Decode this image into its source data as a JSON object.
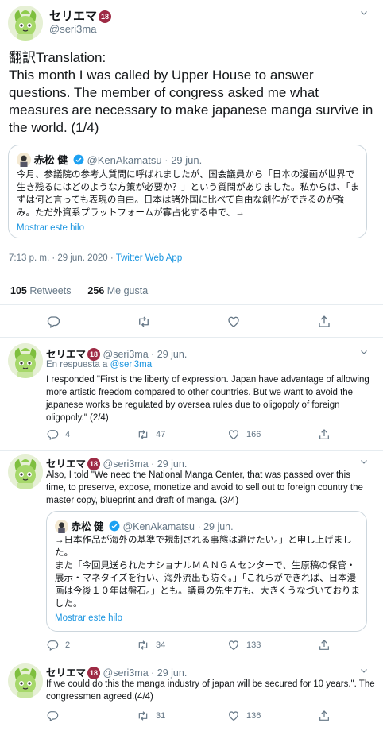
{
  "main": {
    "display_name": "セリエマ",
    "badge": "18",
    "handle": "@seri3ma",
    "text": "翻訳Translation:\nThis month I was called by Upper House to answer questions. The member of congress asked me what measures are necessary to make japanese manga survive in the world. (1/4)",
    "quote": {
      "display_name": "赤松 健",
      "handle": "@KenAkamatsu",
      "date": "· 29 jun.",
      "text": "今月、参議院の参考人質問に呼ばれましたが、国会議員から「日本の漫画が世界で生き残るにはどのような方策が必要か？」という質問がありました。私からは、「まずは何と言っても表現の自由。日本は諸外国に比べて自由な創作ができるのが強み。ただ外資系プラットフォームが寡占化する中で、→",
      "show_thread": "Mostrar este hilo"
    },
    "timestamp": "7:13 p. m. · 29 jun. 2020",
    "source": "Twitter Web App",
    "retweets_count": "105",
    "retweets_label": "Retweets",
    "likes_count": "256",
    "likes_label": "Me gusta"
  },
  "replies": [
    {
      "display_name": "セリエマ",
      "badge": "18",
      "handle": "@seri3ma",
      "date": "· 29 jun.",
      "reply_prefix": "En respuesta a",
      "reply_handle": "@seri3ma",
      "text": "I responded \"First is the liberty of expression. Japan have advantage of allowing more artistic freedom compared to other countries. But we want to avoid the japanese works be regulated by oversea rules due to oligopoly of foreign oligopoly.\" (2/4)",
      "counts": {
        "reply": "4",
        "retweet": "47",
        "like": "166"
      }
    },
    {
      "display_name": "セリエマ",
      "badge": "18",
      "handle": "@seri3ma",
      "date": "· 29 jun.",
      "text": "Also, I told \"We need the National Manga Center, that was passed over this time, to preserve, expose, monetize and avoid to sell out to foreign country the master copy, blueprint and draft of manga.  (3/4)",
      "quote": {
        "display_name": "赤松 健",
        "handle": "@KenAkamatsu",
        "date": "· 29 jun.",
        "text": "→日本作品が海外の基準で規制される事態は避けたい。」と申し上げました。\nまた「今回見送られたナショナルＭＡＮＧＡセンターで、生原稿の保管・展示・マネタイズを行い、海外流出も防ぐ。」「これらができれば、日本漫画は今後１０年は盤石。」とも。議員の先生方も、大きくうなづいておりました。",
        "show_thread": "Mostrar este hilo"
      },
      "counts": {
        "reply": "2",
        "retweet": "34",
        "like": "133"
      }
    },
    {
      "display_name": "セリエマ",
      "badge": "18",
      "handle": "@seri3ma",
      "date": "· 29 jun.",
      "text": "If we could do this the manga industry of japan will be secured for 10 years.\". The congressmen agreed.(4/4)",
      "counts": {
        "reply": "",
        "retweet": "31",
        "like": "136"
      }
    }
  ],
  "icons": {
    "reply": "reply-icon",
    "retweet": "retweet-icon",
    "like": "heart-icon",
    "share": "share-icon",
    "verified": "verified-badge-icon",
    "caret": "chevron-down-icon"
  },
  "colors": {
    "accent": "#1b95e0",
    "muted": "#657786",
    "badge": "#9e2b45",
    "border": "#e6ecf0"
  }
}
